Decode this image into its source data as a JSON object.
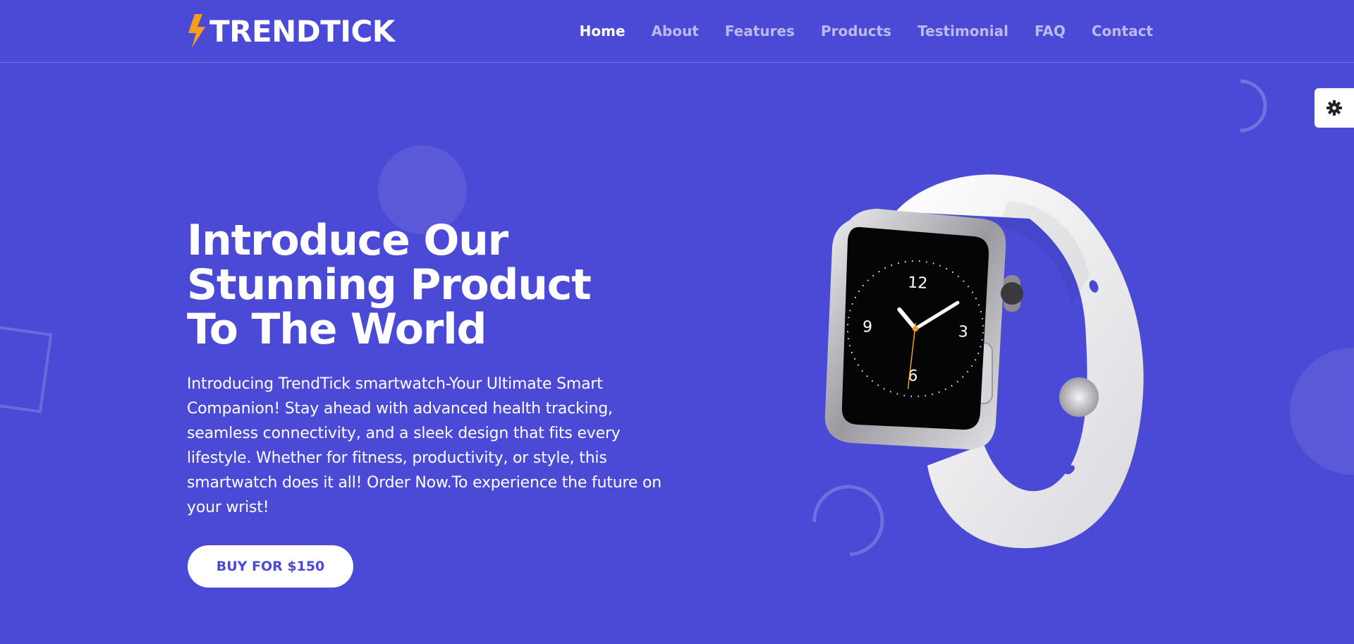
{
  "brand": {
    "name": "TRENDTICK",
    "bolt_color": "#f59e1c"
  },
  "nav": {
    "items": [
      {
        "label": "Home"
      },
      {
        "label": "About"
      },
      {
        "label": "Features"
      },
      {
        "label": "Products"
      },
      {
        "label": "Testimonial"
      },
      {
        "label": "FAQ"
      },
      {
        "label": "Contact"
      }
    ],
    "active": "Home"
  },
  "hero": {
    "title_lines": [
      "Introduce Our",
      "Stunning Product",
      "To The World"
    ],
    "description": "Introducing TrendTick smartwatch-Your Ultimate Smart Companion! Stay ahead with advanced health tracking, seamless connectivity, and a sleek design that fits every lifestyle. Whether for fitness, productivity, or style, this smartwatch does it all! Order Now.To experience the future on your wrist!",
    "cta_label": "BUY FOR $150"
  },
  "watch_face": {
    "numerals": [
      "12",
      "3",
      "6",
      "9"
    ]
  },
  "settings": {
    "icon": "gear-icon"
  },
  "colors": {
    "background": "#4a4ad6",
    "accent": "#f59e1c",
    "text": "#ffffff"
  }
}
